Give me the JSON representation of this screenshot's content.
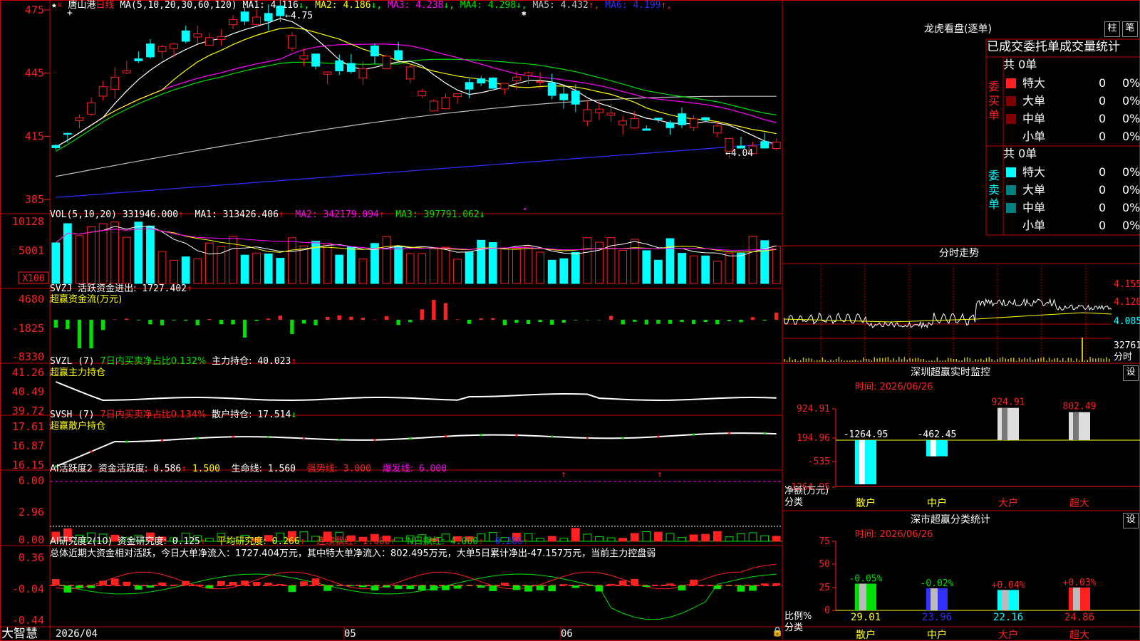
{
  "brand": "大智慧",
  "colors": {
    "up": "#ff2020",
    "down": "#00ffff",
    "grid": "#c00000",
    "yellow": "#ffff00",
    "magenta": "#ff00ff",
    "green": "#00e000",
    "white": "#ffffff",
    "blue": "#3030ff",
    "gray": "#c0c0c0",
    "darkred": "#800000",
    "darkcyan": "#008080"
  },
  "main": {
    "stock": "唐山港",
    "period": "日线",
    "ma_label": "MA(5,10,20,30,60,120)",
    "ma_items": [
      {
        "name": "MA1:",
        "value": "4.116",
        "arrow": "↓",
        "color": "#ffffff"
      },
      {
        "name": "MA2:",
        "value": "4.186",
        "arrow": "↓",
        "color": "#ffff00"
      },
      {
        "name": "MA3:",
        "value": "4.238",
        "arrow": "↓",
        "color": "#ff00ff"
      },
      {
        "name": "MA4:",
        "value": "4.298",
        "arrow": "↓",
        "color": "#00e000"
      },
      {
        "name": "MA5:",
        "value": "4.432",
        "arrow": "↑",
        "color": "#c0c0c0"
      },
      {
        "name": "MA6:",
        "value": "4.199",
        "arrow": "↑",
        "color": "#3030ff"
      }
    ],
    "yticks": [
      "475",
      "445",
      "415",
      "385"
    ],
    "high_label": "4.75",
    "low_label": "4.04",
    "xlabels": [
      "2026/04",
      "05",
      "06"
    ]
  },
  "vol": {
    "title": "VOL(5,10,20)",
    "v0": "331946.000",
    "ma1": "MA1: 313426.406",
    "ma2": "MA2: 342179.094",
    "ma3": "MA3: 397791.062",
    "yticks": [
      "10128",
      "5001"
    ],
    "unit": "X100"
  },
  "svzj": {
    "title": "SVZJ",
    "desc": "活跃资金进出:",
    "value": "1727.402",
    "sub": "超赢资金流(万元)",
    "yticks": [
      "4680",
      "-1825",
      "-8330"
    ]
  },
  "svzl": {
    "title": "SVZL (7)",
    "desc": "7日内买卖净占比0.132%",
    "hold": "主力持仓:",
    "value": "40.023",
    "sub": "超赢主力持仓",
    "yticks": [
      "41.26",
      "40.49",
      "39.72"
    ]
  },
  "svsh": {
    "title": "SVSH (7)",
    "desc": "7日内买卖净占比0.134%",
    "hold": "散户持仓:",
    "value": "17.514",
    "sub": "超赢散户持仓",
    "yticks": [
      "17.61",
      "16.87",
      "16.15"
    ]
  },
  "ai1": {
    "title": "AI活跃度2",
    "d1": "资金活跃度:",
    "v1": "0.586",
    "v2": "1.500",
    "d3": "生命线:",
    "v3": "1.560",
    "d4": "强势线:",
    "v4": "3.000",
    "d5": "爆发线:",
    "v5": "6.000",
    "yticks": [
      "6.00",
      "2.96",
      "0.00"
    ]
  },
  "ai2": {
    "title": "AI研究度2(10)",
    "d1": "资金研究度:",
    "v1": "0.125",
    "d2": "平均研究度:",
    "v2": "0.266",
    "d3": "连续飘红:",
    "v3": "1.000",
    "d4": "N日飘红:",
    "v4": "4.000",
    "v5": "0.266",
    "summary": "总体近期大资金相对活跃，今日大单净流入：1727.404万元，其中特大单净流入：802.495万元，大单5日累计净出-47.157万元，当前主力控盘弱",
    "yticks": [
      "0.36",
      "-0.04",
      "-0.44"
    ]
  },
  "right": {
    "header": "龙虎看盘(逐单)",
    "btn1": "柱",
    "btn2": "笔",
    "stat_title": "已成交委托单成交量统计",
    "buy_label": "委买单",
    "buy_total": "共 0单",
    "sell_label": "委卖单",
    "sell_total": "共 0单",
    "buy_rows": [
      {
        "name": "特大",
        "n": "0",
        "p": "0%"
      },
      {
        "name": "大单",
        "n": "0",
        "p": "0%"
      },
      {
        "name": "中单",
        "n": "0",
        "p": "0%"
      },
      {
        "name": "小单",
        "n": "0",
        "p": "0%"
      }
    ],
    "sell_rows": [
      {
        "name": "特大",
        "n": "0",
        "p": "0%"
      },
      {
        "name": "大单",
        "n": "0",
        "p": "0%"
      },
      {
        "name": "中单",
        "n": "0",
        "p": "0%"
      },
      {
        "name": "小单",
        "n": "0",
        "p": "0%"
      }
    ],
    "fenshi": {
      "title": "分时走势",
      "yticks": [
        "4.155",
        "4.120",
        "4.085",
        "32761",
        "分时"
      ]
    },
    "monitor": {
      "title": "深圳超赢实时监控",
      "btn": "设",
      "time": "时间: 2026/06/26",
      "yticks": [
        "924.91",
        "194.96",
        "-535",
        "-1264.95"
      ],
      "ylabel1": "净额(万元)",
      "ylabel2": "分类",
      "cats": [
        "散户",
        "中户",
        "大户",
        "超大"
      ],
      "values": [
        -1264.95,
        -462.45,
        924.91,
        802.49
      ],
      "value_labels": [
        "-1264.95",
        "-462.45",
        "924.91",
        "802.49"
      ]
    },
    "classify": {
      "title": "深市超赢分类统计",
      "btn": "设",
      "time": "时间: 2026/06/26",
      "yticks": [
        "75",
        "50",
        "25",
        "0"
      ],
      "ylabel1": "比例%",
      "ylabel2": "分类",
      "cats": [
        "散户",
        "中户",
        "大户",
        "超大"
      ],
      "values": [
        29.01,
        23.96,
        22.16,
        24.86
      ],
      "value_labels": [
        "29.01",
        "23.96",
        "22.16",
        "24.86"
      ],
      "changes": [
        "-0.05%",
        "-0.02%",
        "+0.04%",
        "+0.03%"
      ]
    }
  }
}
